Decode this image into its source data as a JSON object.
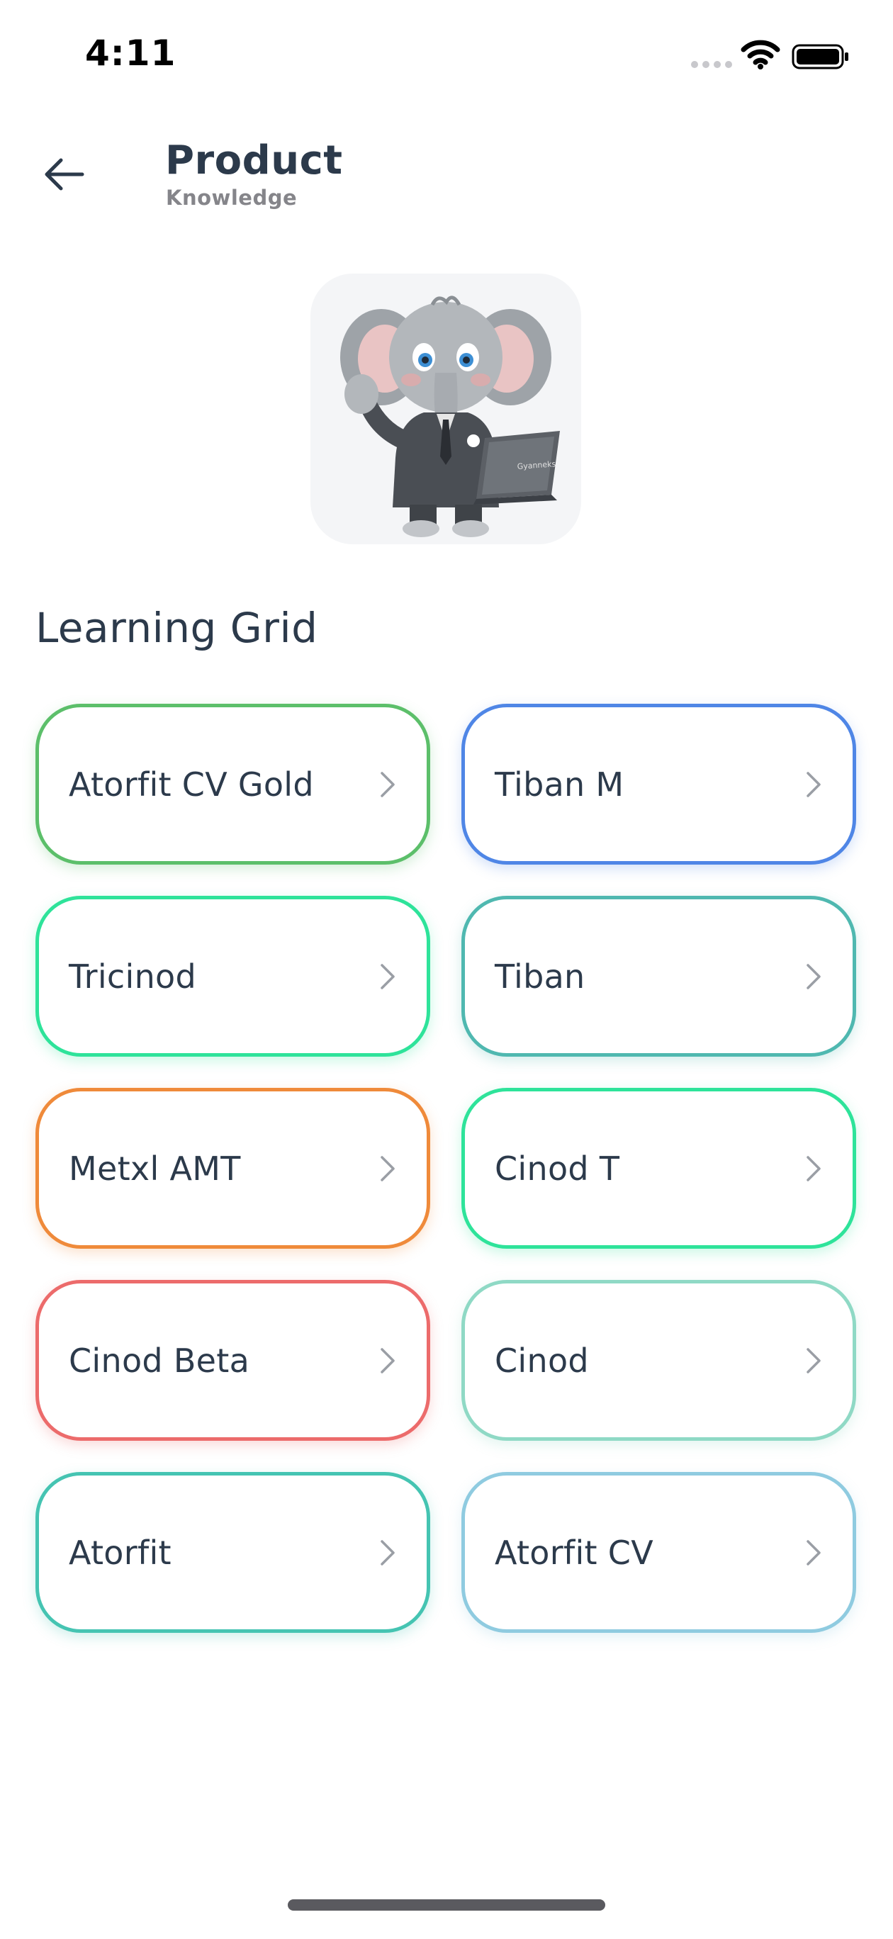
{
  "status_bar": {
    "time": "4:11"
  },
  "header": {
    "title": "Product",
    "subtitle": "Knowledge"
  },
  "mascot": {
    "laptop_text": "Gyanneks"
  },
  "section": {
    "title": "Learning Grid"
  },
  "grid": {
    "items": [
      {
        "label": "Atorfit CV Gold",
        "color": "#5cbf6a"
      },
      {
        "label": "Tiban M",
        "color": "#4f86e6"
      },
      {
        "label": "Tricinod",
        "color": "#2ee39a"
      },
      {
        "label": "Tiban",
        "color": "#4fb8b0"
      },
      {
        "label": "Metxl AMT",
        "color": "#ef8a3a"
      },
      {
        "label": "Cinod T",
        "color": "#2ee39a"
      },
      {
        "label": "Cinod Beta",
        "color": "#ec6b6b"
      },
      {
        "label": "Cinod",
        "color": "#8fd9c5"
      },
      {
        "label": "Atorfit",
        "color": "#45c4b2"
      },
      {
        "label": "Atorfit CV",
        "color": "#8fcbe0"
      }
    ]
  },
  "icons": {
    "back": "arrow-left-icon",
    "chevron": "chevron-right-icon",
    "wifi": "wifi-icon",
    "battery": "battery-icon",
    "signal": "signal-icon"
  }
}
